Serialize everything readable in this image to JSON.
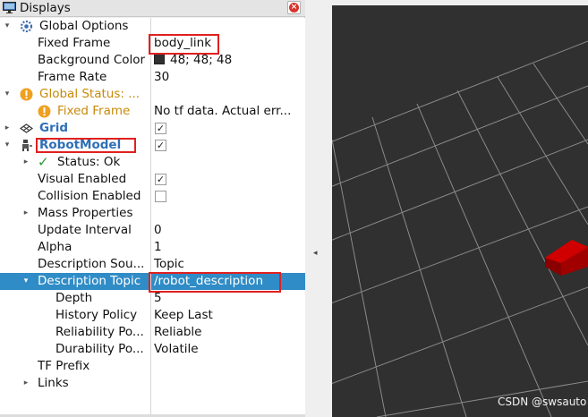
{
  "panel": {
    "title": "Displays",
    "close_glyph": "×"
  },
  "tree": {
    "global_options": {
      "label": "Global Options"
    },
    "fixed_frame": {
      "label": "Fixed Frame",
      "value": "body_link"
    },
    "background_color": {
      "label": "Background Color",
      "value": "48; 48; 48",
      "color": "#303030"
    },
    "frame_rate": {
      "label": "Frame Rate",
      "value": "30"
    },
    "global_status": {
      "label": "Global Status: ..."
    },
    "status_fixed_frame": {
      "label": "Fixed Frame",
      "value": "No tf data.  Actual err..."
    },
    "grid": {
      "label": "Grid",
      "checked": true
    },
    "robot_model": {
      "label": "RobotModel",
      "checked": true
    },
    "status_ok": {
      "label": "Status: Ok"
    },
    "visual_enabled": {
      "label": "Visual Enabled",
      "checked": true
    },
    "collision_enabled": {
      "label": "Collision Enabled",
      "checked": false
    },
    "mass_properties": {
      "label": "Mass Properties"
    },
    "update_interval": {
      "label": "Update Interval",
      "value": "0"
    },
    "alpha": {
      "label": "Alpha",
      "value": "1"
    },
    "description_source": {
      "label": "Description Sou...",
      "value": "Topic"
    },
    "description_topic": {
      "label": "Description Topic",
      "value": "/robot_description"
    },
    "depth": {
      "label": "Depth",
      "value": "5"
    },
    "history_policy": {
      "label": "History Policy",
      "value": "Keep Last"
    },
    "reliability_policy": {
      "label": "Reliability Po...",
      "value": "Reliable"
    },
    "durability_policy": {
      "label": "Durability Po...",
      "value": "Volatile"
    },
    "tf_prefix": {
      "label": "TF Prefix"
    },
    "links": {
      "label": "Links"
    }
  },
  "icons": {
    "check": "✓",
    "expand": "▾",
    "collapse": "▸",
    "warning": "!"
  },
  "view": {
    "background": "#303030",
    "robot_color": "#b00000",
    "watermark": "CSDN @swsauto"
  }
}
